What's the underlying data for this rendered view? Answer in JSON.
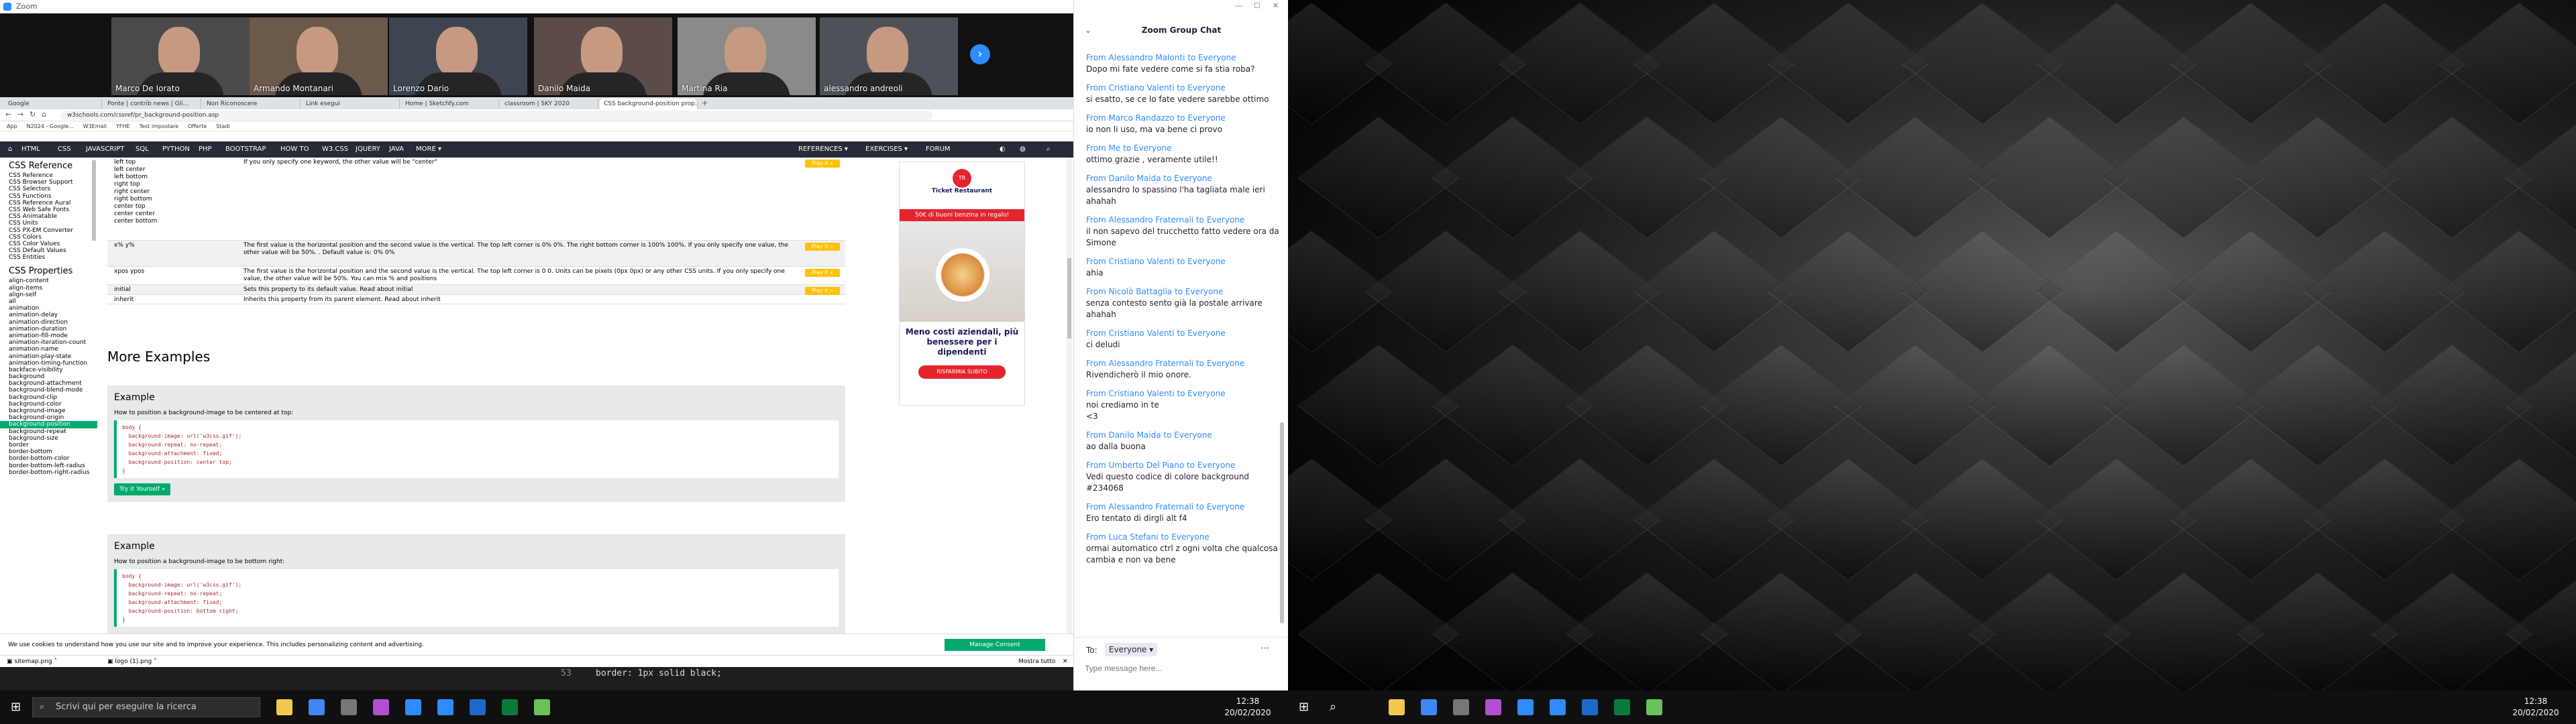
{
  "zoom": {
    "window_title": "Zoom",
    "participants": [
      "Marco De Iorato",
      "Armando Montanari",
      "Lorenzo Dario",
      "Danilo Maida",
      "Martina Ria",
      "alessandro andreoli"
    ],
    "participant_colors": [
      "#4a4a4a",
      "#6b5a4a",
      "#3d4650",
      "#5c4c48",
      "#8a8a8a",
      "#4e5258"
    ]
  },
  "browser": {
    "tabs": [
      "Google",
      "Ponte | contrib news | Gli...",
      "Non Riconoscere",
      "Link esegui",
      "Home | Sketchfy.com",
      "classroom | SKY 2020",
      "CSS background-position prop..."
    ],
    "url": "w3schools.com/cssref/pr_background-position.asp",
    "bookmarks": [
      "App",
      "N2024 - Google...",
      "W3Email",
      "YFHE",
      "Test impostare",
      "Offerte",
      "Stadi"
    ]
  },
  "w3": {
    "nav": [
      "HTML",
      "CSS",
      "JAVASCRIPT",
      "SQL",
      "PYTHON",
      "PHP",
      "BOOTSTRAP",
      "HOW TO",
      "W3.CSS",
      "JQUERY",
      "JAVA",
      "MORE ▾",
      "REFERENCES ▾",
      "EXERCISES ▾",
      "FORUM"
    ],
    "sidebar": {
      "ref_heading": "CSS Reference",
      "ref_items": [
        "CSS Reference",
        "CSS Browser Support",
        "CSS Selectors",
        "CSS Functions",
        "CSS Reference Aural",
        "CSS Web Safe Fonts",
        "CSS Animatable",
        "CSS Units",
        "CSS PX-EM Converter",
        "CSS Colors",
        "CSS Color Values",
        "CSS Default Values",
        "CSS Entities"
      ],
      "prop_heading": "CSS Properties",
      "prop_items": [
        "align-content",
        "align-items",
        "align-self",
        "all",
        "animation",
        "animation-delay",
        "animation-direction",
        "animation-duration",
        "animation-fill-mode",
        "animation-iteration-count",
        "animation-name",
        "animation-play-state",
        "animation-timing-function",
        "backface-visibility",
        "background",
        "background-attachment",
        "background-blend-mode",
        "background-clip",
        "background-color",
        "background-image",
        "background-origin",
        "background-position",
        "background-repeat",
        "background-size",
        "border",
        "border-bottom",
        "border-bottom-color",
        "border-bottom-left-radius",
        "border-bottom-right-radius"
      ],
      "selected": "background-position"
    },
    "values_table": [
      {
        "value": "left top\nleft center\nleft bottom\nright top\nright center\nright bottom\ncenter top\ncenter center\ncenter bottom",
        "desc": "If you only specify one keyword, the other value will be \"center\"",
        "btn": "Play it »"
      },
      {
        "value": "x% y%",
        "desc": "The first value is the horizontal position and the second value is the vertical. The top left corner is 0% 0%. The right bottom corner is 100% 100%. If you only specify one value, the other value will be 50%. . Default value is: 0% 0%",
        "btn": "Play it »"
      },
      {
        "value": "xpos ypos",
        "desc": "The first value is the horizontal position and the second value is the vertical. The top left corner is 0 0. Units can be pixels (0px 0px) or any other CSS units. If you only specify one value, the other value will be 50%. You can mix % and positions",
        "btn": "Play it »"
      },
      {
        "value": "initial",
        "desc": "Sets this property to its default value. Read about initial",
        "btn": "Play it »"
      },
      {
        "value": "inherit",
        "desc": "Inherits this property from its parent element. Read about inherit",
        "btn": ""
      }
    ],
    "more_examples": "More Examples",
    "examples": [
      {
        "heading": "Example",
        "desc": "How to position a background-image to be centered at top:",
        "code": [
          "body {",
          "  background-image: url('w3css.gif');",
          "  background-repeat: no-repeat;",
          "  background-attachment: fixed;",
          "  background-position: center top;",
          "}"
        ],
        "try": "Try it Yourself »"
      },
      {
        "heading": "Example",
        "desc": "How to position a background-image to be bottom right:",
        "code": [
          "body {",
          "  background-image: url('w3css.gif');",
          "  background-repeat: no-repeat;",
          "  background-attachment: fixed;",
          "  background-position: bottom right;",
          "}"
        ],
        "try": ""
      }
    ],
    "ad": {
      "brand": "Ticket Restaurant",
      "promo": "50€ di buoni benzina in regalo!",
      "headline": "Meno costi aziendali, più benessere per i dipendenti",
      "cta": "RISPARMIA SUBITO"
    },
    "cookie_text": "We use cookies to understand how you use our site and to improve your experience. This includes personalizing content and advertising.",
    "cookie_button": "Manage Consent",
    "downloads": [
      "sitemap.png",
      "logo (1).png"
    ],
    "downloads_show_all": "Mostra tutto"
  },
  "terminal": {
    "line": "border: 1px solid black;"
  },
  "chat": {
    "title": "Zoom Group Chat",
    "messages": [
      {
        "from": "Alessandro Malonti",
        "to": "Everyone",
        "text": "Dopo mi fate vedere come si fa stia roba?"
      },
      {
        "from": "Cristiano Valenti",
        "to": "Everyone",
        "text": "si esatto, se ce lo fate vedere sarebbe ottimo"
      },
      {
        "from": "Marco Randazzo",
        "to": "Everyone",
        "text": "io non li uso, ma va bene ci provo"
      },
      {
        "from": "Me",
        "to": "Everyone",
        "text": "ottimo grazie , veramente utile!!"
      },
      {
        "from": "Danilo Maida",
        "to": "Everyone",
        "text": "alessandro lo spassino l'ha tagliata male ieri ahahah"
      },
      {
        "from": "Alessandro Fraternali",
        "to": "Everyone",
        "text": "il non sapevo del trucchetto fatto vedere ora da Simone"
      },
      {
        "from": "Cristiano Valenti",
        "to": "Everyone",
        "text": "ahia"
      },
      {
        "from": "Nicolò Battaglia",
        "to": "Everyone",
        "text": "senza contesto sento già la postale arrivare ahahah"
      },
      {
        "from": "Cristiano Valenti",
        "to": "Everyone",
        "text": "ci deludi"
      },
      {
        "from": "Alessandro Fraternali",
        "to": "Everyone",
        "text": "Rivendicherò il mio onore."
      },
      {
        "from": "Cristiano Valenti",
        "to": "Everyone",
        "text": "noi crediamo in te\n<3"
      },
      {
        "from": "Danilo Maida",
        "to": "Everyone",
        "text": "ao dalla buona"
      },
      {
        "from": "Umberto Del Piano",
        "to": "Everyone",
        "text": "Vedi questo codice di colore background #234068"
      },
      {
        "from": "Alessandro Fraternali",
        "to": "Everyone",
        "text": "Ero tentato di dirgli alt f4"
      },
      {
        "from": "Luca Stefani",
        "to": "Everyone",
        "text": "ormai automatico ctrl z ogni volta che qualcosa cambia e non va bene"
      }
    ],
    "to_label": "To:",
    "to_value": "Everyone",
    "input_placeholder": "Type message here..."
  },
  "taskbar": {
    "search_placeholder": "Scrivi qui per eseguire la ricerca",
    "time": "12:38",
    "date": "20/02/2020",
    "icon_colors": [
      "#f2c94c",
      "#4285f4",
      "#777",
      "#b04fcf",
      "#2d8cff",
      "#2d8cff",
      "#1b6ac9",
      "#0b7a3b",
      "#6ac259"
    ]
  }
}
